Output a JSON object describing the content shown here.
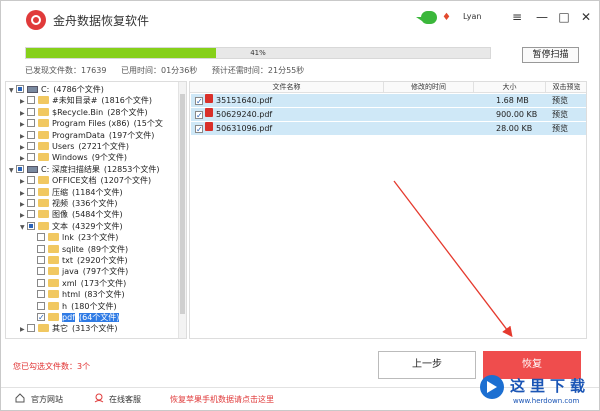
{
  "app": {
    "title": "金舟数据恢复软件",
    "username": "Lyan",
    "vip_icon": "diamond-icon",
    "wechat_icon": "wechat-icon"
  },
  "window_controls": {
    "menu": "≡",
    "minimize": "—",
    "maximize": "□",
    "close": "✕"
  },
  "scan": {
    "progress_percent": 41,
    "progress_label": "41%",
    "pause_label": "暂停扫描"
  },
  "stats": {
    "found": "已发现文件数：17639",
    "elapsed": "已用时间：01分36秒",
    "remaining": "预计还需时间：21分55秒"
  },
  "tree": [
    {
      "name": "C:",
      "count": "(4786个文件)",
      "icon": "drive",
      "exp": "▼",
      "check": "part"
    },
    {
      "name": "#未知目录#",
      "count": "(1816个文件)",
      "icon": "folder",
      "exp": "▶",
      "check": "none"
    },
    {
      "name": "$Recycle.Bin",
      "count": "(28个文件)",
      "icon": "folder",
      "exp": "▶",
      "check": "none"
    },
    {
      "name": "Program Files (x86)",
      "count": "(15个文",
      "icon": "folder",
      "exp": "▶",
      "check": "none"
    },
    {
      "name": "ProgramData",
      "count": "(197个文件)",
      "icon": "folder",
      "exp": "▶",
      "check": "none"
    },
    {
      "name": "Users",
      "count": "(2721个文件)",
      "icon": "folder",
      "exp": "▶",
      "check": "none"
    },
    {
      "name": "Windows",
      "count": "(9个文件)",
      "icon": "folder",
      "exp": "▶",
      "check": "none"
    },
    {
      "name": "C: 深度扫描结果",
      "count": "(12853个文件)",
      "icon": "drive",
      "exp": "▼",
      "check": "part"
    },
    {
      "name": "OFFICE文档",
      "count": "(1207个文件)",
      "icon": "folder",
      "exp": "▶",
      "check": "none"
    },
    {
      "name": "压缩",
      "count": "(1184个文件)",
      "icon": "folder",
      "exp": "▶",
      "check": "none"
    },
    {
      "name": "视频",
      "count": "(336个文件)",
      "icon": "folder",
      "exp": "▶",
      "check": "none"
    },
    {
      "name": "图像",
      "count": "(5484个文件)",
      "icon": "folder",
      "exp": "▶",
      "check": "none"
    },
    {
      "name": "文本",
      "count": "(4329个文件)",
      "icon": "folder",
      "exp": "▼",
      "check": "part"
    },
    {
      "name": "lnk",
      "count": "(23个文件)",
      "icon": "folder",
      "exp": "",
      "check": "none"
    },
    {
      "name": "sqlite",
      "count": "(89个文件)",
      "icon": "folder",
      "exp": "",
      "check": "none"
    },
    {
      "name": "txt",
      "count": "(2920个文件)",
      "icon": "folder",
      "exp": "",
      "check": "none"
    },
    {
      "name": "java",
      "count": "(797个文件)",
      "icon": "folder",
      "exp": "",
      "check": "none"
    },
    {
      "name": "xml",
      "count": "(173个文件)",
      "icon": "folder",
      "exp": "",
      "check": "none"
    },
    {
      "name": "html",
      "count": "(83个文件)",
      "icon": "folder",
      "exp": "",
      "check": "none"
    },
    {
      "name": "h",
      "count": "(180个文件)",
      "icon": "folder",
      "exp": "",
      "check": "none"
    },
    {
      "name": "pdf",
      "count": "(64个文件)",
      "icon": "folder",
      "exp": "",
      "check": "on",
      "selected": true
    },
    {
      "name": "其它",
      "count": "(313个文件)",
      "icon": "folder",
      "exp": "▶",
      "check": "none"
    }
  ],
  "file_table": {
    "headers": {
      "name": "文件名称",
      "modified": "修改的时间",
      "size": "大小",
      "preview": "双击预览"
    },
    "rows": [
      {
        "name": "35151640.pdf",
        "modified": "",
        "size": "1.68 MB",
        "preview": "预览"
      },
      {
        "name": "50629240.pdf",
        "modified": "",
        "size": "900.00 KB",
        "preview": "预览"
      },
      {
        "name": "50631096.pdf",
        "modified": "",
        "size": "28.00 KB",
        "preview": "预览"
      }
    ]
  },
  "selection": {
    "label": "您已勾选文件数：3个"
  },
  "buttons": {
    "prev": "上一步",
    "recover": "恢复"
  },
  "footer": {
    "website": "官方网站",
    "support": "在线客服",
    "promo": "恢复苹果手机数据请点击这里"
  },
  "watermark": {
    "text": "这里下载",
    "url": "www.herdown.com"
  },
  "colors": {
    "accent": "#ef4d4d",
    "progress": "#86d01a",
    "selection": "#2f7be5",
    "row_bg": "#cfe8f7"
  }
}
